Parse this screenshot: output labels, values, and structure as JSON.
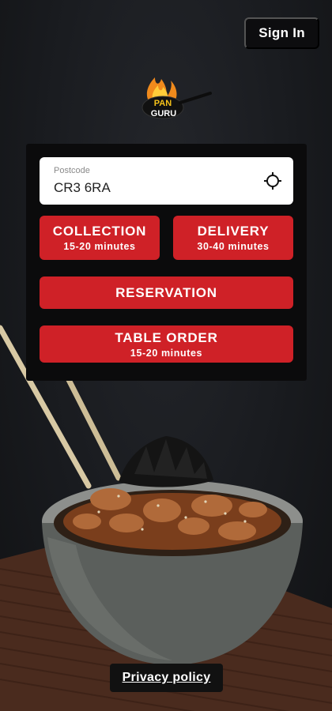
{
  "header": {
    "sign_in_label": "Sign In"
  },
  "brand": {
    "logo_line1": "PAN",
    "logo_line2": "GURU"
  },
  "postcode": {
    "label": "Postcode",
    "value": "CR3 6RA"
  },
  "order_options": [
    {
      "title": "COLLECTION",
      "subtitle": "15-20 minutes"
    },
    {
      "title": "DELIVERY",
      "subtitle": "30-40 minutes"
    },
    {
      "title": "RESERVATION",
      "subtitle": ""
    },
    {
      "title": "TABLE ORDER",
      "subtitle": "15-20 minutes"
    }
  ],
  "footer": {
    "privacy_label": "Privacy policy"
  },
  "colors": {
    "accent": "#cf2127",
    "panel": "#0b0b0c",
    "background": "#15171b"
  },
  "icons": {
    "location": "crosshair-icon",
    "logo_flame": "flame-icon",
    "logo_pan": "pan-icon"
  }
}
